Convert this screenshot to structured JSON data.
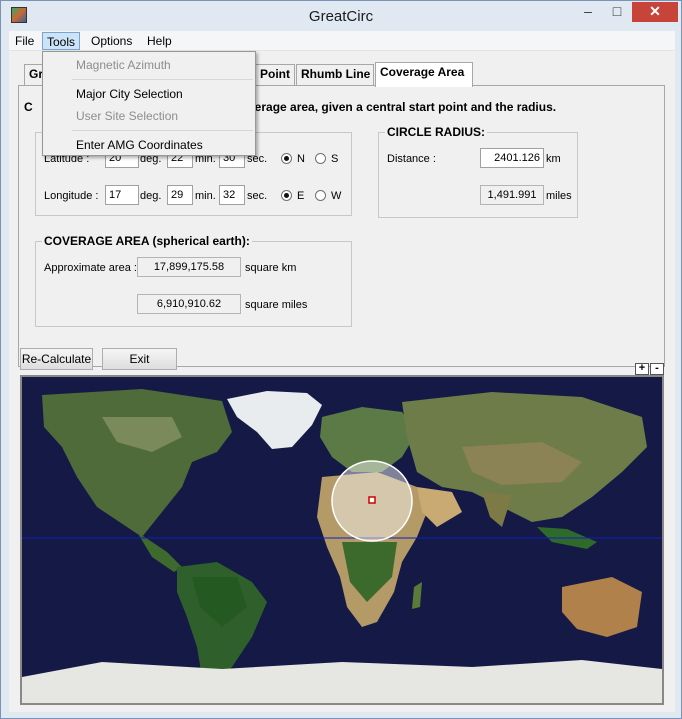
{
  "window": {
    "title": "GreatCirc"
  },
  "menubar": {
    "items": [
      "File",
      "Tools",
      "Options",
      "Help"
    ]
  },
  "tools_menu": {
    "items": [
      {
        "label": "Magnetic Azimuth",
        "enabled": false
      },
      {
        "label": "Major City Selection",
        "enabled": true
      },
      {
        "label": "User Site Selection",
        "enabled": false
      },
      {
        "label": "Enter AMG Coordinates",
        "enabled": true
      }
    ]
  },
  "tabs": [
    {
      "label": "Gr",
      "selected": false
    },
    {
      "label": "Point",
      "selected": false
    },
    {
      "label": "Rhumb Line",
      "selected": false
    },
    {
      "label": "Coverage Area",
      "selected": true
    }
  ],
  "panel": {
    "desc_left": "C",
    "desc_right": "verage area, given a central start point and the radius."
  },
  "start_point": {
    "lat_label": "Latitude :",
    "lat_deg": "20",
    "lat_min": "22",
    "lat_sec": "30",
    "lat_ns_selected": "N",
    "lon_label": "Longitude :",
    "lon_deg": "17",
    "lon_min": "29",
    "lon_sec": "32",
    "lon_ew_selected": "E",
    "deg_label": "deg.",
    "min_label": "min.",
    "sec_label": "sec.",
    "N": "N",
    "S": "S",
    "E": "E",
    "W": "W"
  },
  "circle_radius": {
    "title": "CIRCLE RADIUS:",
    "distance_label": "Distance :",
    "distance_km": "2401.126",
    "km_unit": "km",
    "distance_miles": "1,491.991",
    "miles_unit": "miles"
  },
  "coverage": {
    "title": "COVERAGE AREA (spherical earth):",
    "approx_label": "Approximate area :",
    "area_km": "17,899,175.58",
    "km_unit": "square km",
    "area_miles": "6,910,910.62",
    "miles_unit": "square miles"
  },
  "buttons": {
    "recalc": "Re-Calculate",
    "exit": "Exit",
    "zoom_in": "+",
    "zoom_out": "-"
  },
  "colors": {
    "ocean": "#141a45",
    "equator": "#1020c0",
    "coverage_circle": "#ffffff",
    "center_marker": "#cc0000"
  }
}
